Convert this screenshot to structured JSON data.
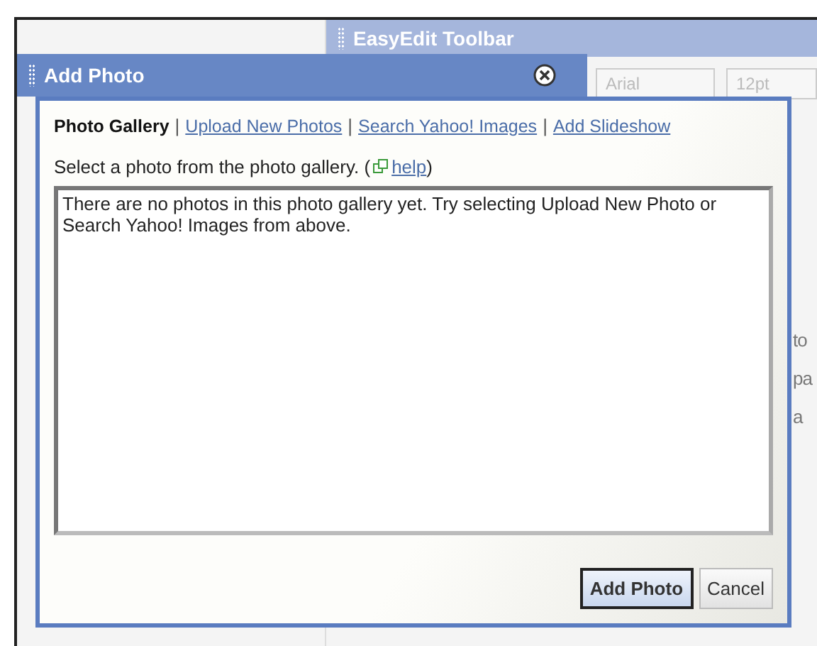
{
  "background": {
    "toolbar_title": "EasyEdit Toolbar",
    "font_field": "Arial",
    "size_field": "12pt",
    "text_fragments": [
      "to",
      "pa",
      "a"
    ]
  },
  "dialog": {
    "title": "Add Photo",
    "tabs": [
      {
        "label": "Photo Gallery",
        "selected": true
      },
      {
        "label": "Upload New Photos",
        "selected": false
      },
      {
        "label": "Search Yahoo! Images",
        "selected": false
      },
      {
        "label": "Add Slideshow",
        "selected": false
      }
    ],
    "tab_separators": [
      "|",
      "|",
      "|"
    ],
    "instruction": "Select a photo from the photo gallery. (",
    "help_link": "help",
    "instruction_end": ")",
    "gallery_message": "There are no photos in this photo gallery yet. Try selecting Upload New Photo or Search Yahoo! Images from above.",
    "buttons": [
      {
        "label": "Add Photo",
        "default": true
      },
      {
        "label": "Cancel",
        "default": false
      }
    ]
  }
}
